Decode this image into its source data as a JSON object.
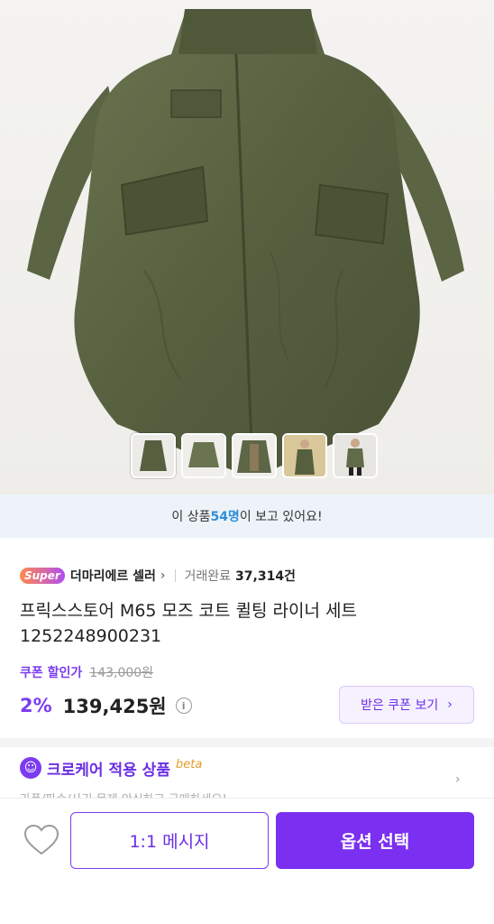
{
  "viewers": {
    "prefix": "이 상품 ",
    "count": "54명",
    "suffix": "이 보고 있어요!"
  },
  "seller": {
    "badge": "Super",
    "name": "더마리에르 셀러",
    "chevron": "›",
    "trades_label": "거래완료",
    "trades_count": "37,314건"
  },
  "product": {
    "title_line1": "프릭스스토어 M65 모즈 코트 퀼팅 라이너 세트",
    "title_line2": "1252248900231"
  },
  "price": {
    "coupon_label": "쿠폰 할인가",
    "original": "143,000원",
    "discount": "2%",
    "final": "139,425원",
    "info_icon": "i"
  },
  "coupon_button": {
    "label": "받은 쿠폰 보기",
    "arrow": "›"
  },
  "care": {
    "icon": "☺",
    "title": "크로케어 적용 상품",
    "beta": "beta",
    "subtitle": "가품/파손/사기 문제 안심하고 구매하세요!",
    "chevron": "›"
  },
  "bottom": {
    "message_label": "1:1 메시지",
    "option_label": "옵션 선택"
  },
  "colors": {
    "accent": "#7b2ff0",
    "viewer_count": "#2f8fd8",
    "coat_green": "#56603f"
  },
  "icons": [
    "heart-icon",
    "info-icon",
    "chevron-right-icon",
    "smile-icon"
  ]
}
